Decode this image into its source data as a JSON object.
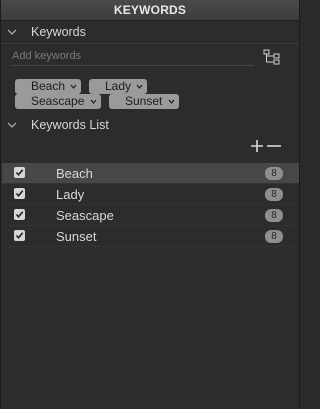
{
  "title": "KEYWORDS",
  "keywords_section": {
    "label": "Keywords",
    "input_placeholder": "Add keywords",
    "tags": [
      "Beach",
      "Lady",
      "Seascape",
      "Sunset"
    ]
  },
  "keywords_list": {
    "label": "Keywords List",
    "rows": [
      {
        "label": "Beach",
        "count": "8",
        "checked": true
      },
      {
        "label": "Lady",
        "count": "8",
        "checked": true
      },
      {
        "label": "Seascape",
        "count": "8",
        "checked": true
      },
      {
        "label": "Sunset",
        "count": "8",
        "checked": true
      }
    ]
  },
  "icons": {
    "collapse": "chevron-down-icon",
    "hierarchy": "hierarchy-icon",
    "add": "plus-icon",
    "remove": "minus-icon",
    "check": "checkmark-icon"
  }
}
